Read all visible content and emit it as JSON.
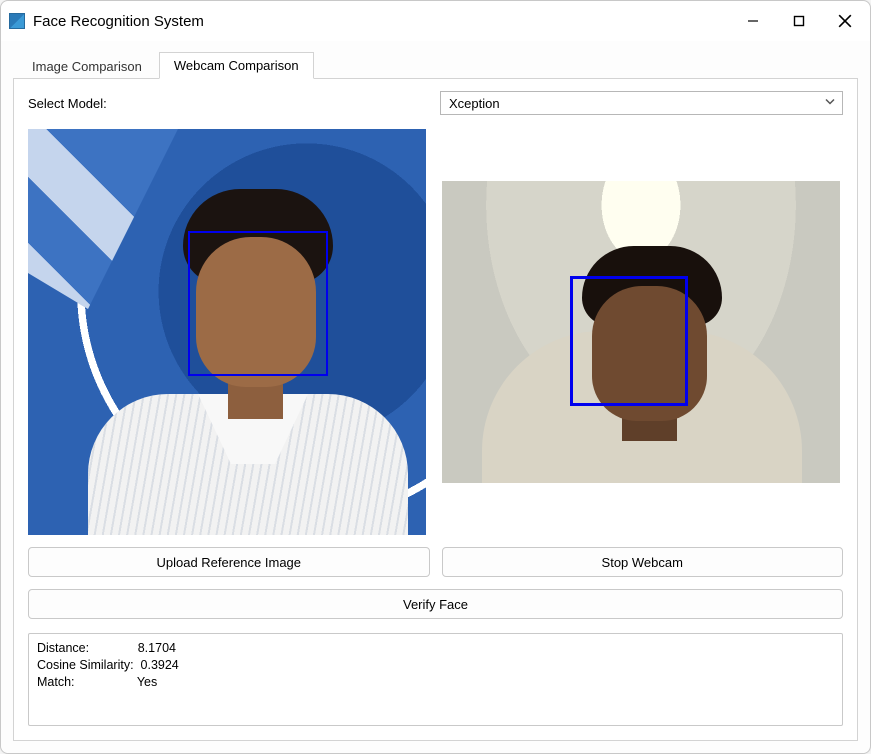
{
  "window": {
    "title": "Face Recognition System"
  },
  "tabs": {
    "image_comparison": "Image Comparison",
    "webcam_comparison": "Webcam Comparison"
  },
  "model_select": {
    "label": "Select Model:",
    "value": "Xception"
  },
  "buttons": {
    "upload_reference": "Upload Reference Image",
    "stop_webcam": "Stop Webcam",
    "verify_face": "Verify Face"
  },
  "results": {
    "distance_label": "Distance:",
    "distance_value": "8.1704",
    "cosine_label": "Cosine Similarity:",
    "cosine_value": "0.3924",
    "match_label": "Match:",
    "match_value": "Yes"
  }
}
